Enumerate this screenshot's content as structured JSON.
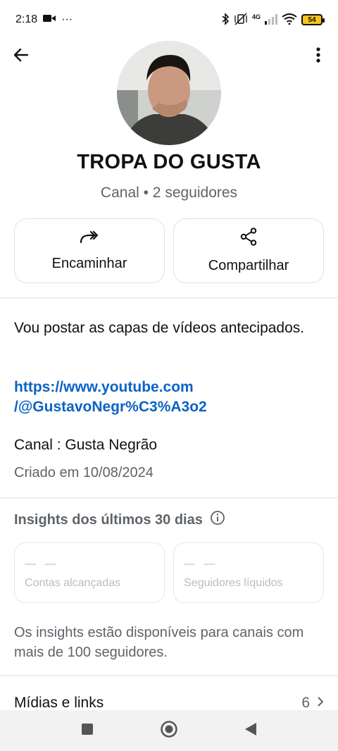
{
  "status_bar": {
    "time": "2:18",
    "overflow": "···",
    "network": "4G",
    "battery": "54",
    "icons": [
      "video-camera-icon",
      "bluetooth-icon",
      "vibrate-off-icon",
      "signal-icon",
      "wifi-icon",
      "battery-icon"
    ]
  },
  "header": {
    "back_icon": "arrow-left-icon",
    "more_icon": "more-vertical-icon"
  },
  "channel": {
    "name": "TROPA DO GUSTA",
    "subtitle": "Canal • 2 seguidores"
  },
  "actions": {
    "forward_label": "Encaminhar",
    "forward_icon": "forward-icon",
    "share_label": "Compartilhar",
    "share_icon": "share-icon"
  },
  "about": {
    "description": "Vou postar as capas de vídeos antecipados.",
    "link_line1": "https://www.youtube.com",
    "link_line2": "/@GustavoNegr%C3%A3o2",
    "channel_line": "Canal : Gusta Negrão",
    "created": "Criado em 10/08/2024"
  },
  "insights": {
    "title": "Insights dos últimos 30 dias",
    "info_icon": "info-icon",
    "cards": [
      {
        "value": "— —",
        "label": "Contas alcançadas"
      },
      {
        "value": "— —",
        "label": "Seguidores líquidos"
      }
    ],
    "note": "Os insights estão disponíveis para canais com mais de 100 seguidores."
  },
  "media": {
    "label": "Mídias e links",
    "count": "6"
  },
  "nav": {
    "icons": [
      "recents-square-icon",
      "home-circle-icon",
      "back-triangle-icon"
    ]
  },
  "colors": {
    "link": "#0b63c4",
    "muted": "#5e6469",
    "border": "#dfe3e6",
    "nav_bg": "#f2f2f2"
  }
}
